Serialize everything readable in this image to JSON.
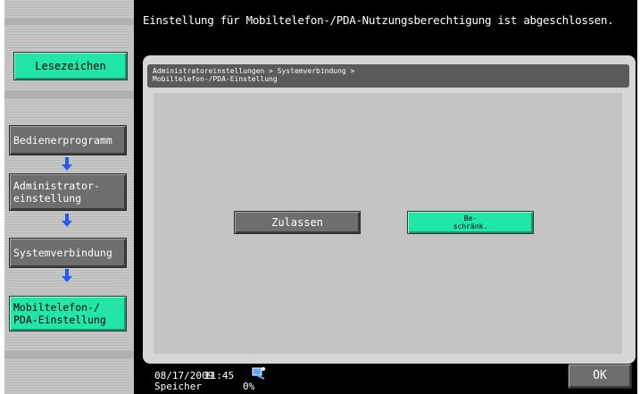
{
  "header": {
    "message": "Einstellung für Mobiltelefon-/PDA-Nutzungsberechtigung ist abgeschlossen."
  },
  "sidebar": {
    "bookmark_label": "Lesezeichen",
    "steps": [
      {
        "label": "Bedienerprogramm"
      },
      {
        "label": "Administrator-\neinstellung"
      },
      {
        "label": "Systemverbindung"
      },
      {
        "label": "Mobiltelefon-/\nPDA-Einstellung"
      }
    ],
    "arrow_icon": "down-arrow-icon"
  },
  "main": {
    "breadcrumb": "Administratoreinstellungen > Systemverbindung >\nMobiltelefon-/PDA-Einstellung",
    "buttons": {
      "allow_label": "Zulassen",
      "restrict_label": "Be-\nschränk."
    }
  },
  "status": {
    "date": "08/17/2009",
    "time": "11:45",
    "memory_label": "Speicher",
    "memory_value": "0%",
    "network_icon": "network-status-icon"
  },
  "footer": {
    "ok_label": "OK"
  },
  "colors": {
    "accent_green": "#22e6a8",
    "button_gray": "#6e6e6e",
    "background_black": "#000000"
  }
}
